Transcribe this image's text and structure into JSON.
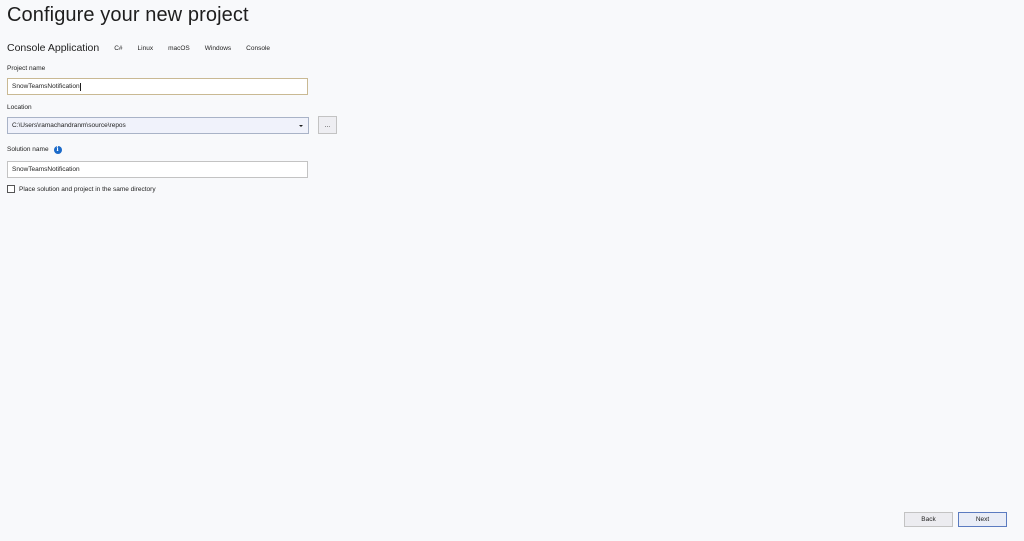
{
  "header": {
    "title": "Configure your new project"
  },
  "template": {
    "name": "Console Application",
    "tags": [
      "C#",
      "Linux",
      "macOS",
      "Windows",
      "Console"
    ]
  },
  "project_name": {
    "label": "Project name",
    "value": "SnowTeamsNotification"
  },
  "location": {
    "label": "Location",
    "value": "C:\\Users\\ramachandranm\\source\\repos",
    "browse_label": "..."
  },
  "solution_name": {
    "label": "Solution name",
    "info_glyph": "i",
    "value": "SnowTeamsNotification"
  },
  "same_directory": {
    "label": "Place solution and project in the same directory",
    "checked": false
  },
  "footer": {
    "back_label": "Back",
    "next_label": "Next"
  },
  "colors": {
    "background": "#f8f9fb",
    "focus_border": "#c9b993",
    "info_icon": "#1b6ac9",
    "next_border": "#5b7bc0"
  }
}
